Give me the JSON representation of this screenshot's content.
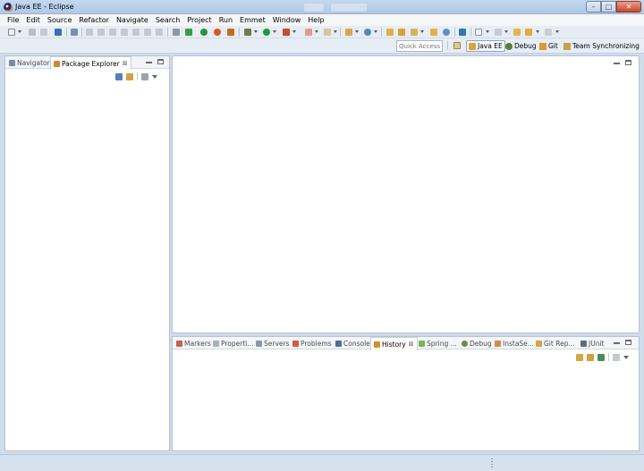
{
  "window": {
    "title": "Java EE - Eclipse",
    "min_glyph": "–",
    "max_glyph": "□",
    "close_glyph": "✕"
  },
  "menu": [
    "File",
    "Edit",
    "Source",
    "Refactor",
    "Navigate",
    "Search",
    "Project",
    "Run",
    "Emmet",
    "Window",
    "Help"
  ],
  "toolbar": {
    "quick_access_placeholder": "Quick Access"
  },
  "perspectives": [
    {
      "label": "Java EE",
      "icon": "java-ee-icon",
      "active": true
    },
    {
      "label": "Debug",
      "icon": "debug-icon",
      "active": false
    },
    {
      "label": "Git",
      "icon": "git-icon",
      "active": false
    },
    {
      "label": "Team Synchronizing",
      "icon": "team-sync-icon",
      "active": false
    }
  ],
  "left_panel": {
    "tabs": [
      {
        "label": "Navigator",
        "icon": "navigator-icon",
        "active": false
      },
      {
        "label": "Package Explorer",
        "icon": "package-explorer-icon",
        "active": true,
        "close": "⊠"
      }
    ]
  },
  "bottom_panel": {
    "tabs": [
      {
        "label": "Markers",
        "icon": "markers-icon"
      },
      {
        "label": "Properti...",
        "icon": "properties-icon"
      },
      {
        "label": "Servers",
        "icon": "servers-icon"
      },
      {
        "label": "Problems",
        "icon": "problems-icon"
      },
      {
        "label": "Console",
        "icon": "console-icon"
      },
      {
        "label": "History",
        "icon": "history-icon",
        "active": true,
        "close": "⊠"
      },
      {
        "label": "Spring ...",
        "icon": "spring-icon"
      },
      {
        "label": "Debug",
        "icon": "debug-icon"
      },
      {
        "label": "InstaSe...",
        "icon": "instasearch-icon"
      },
      {
        "label": "Git Rep...",
        "icon": "git-repositories-icon"
      },
      {
        "label": "JUnit",
        "icon": "junit-icon"
      }
    ]
  },
  "colors": {
    "accent": "#2a5fa8",
    "panel_border": "#b6c3d3",
    "background": "#cfdcea"
  }
}
